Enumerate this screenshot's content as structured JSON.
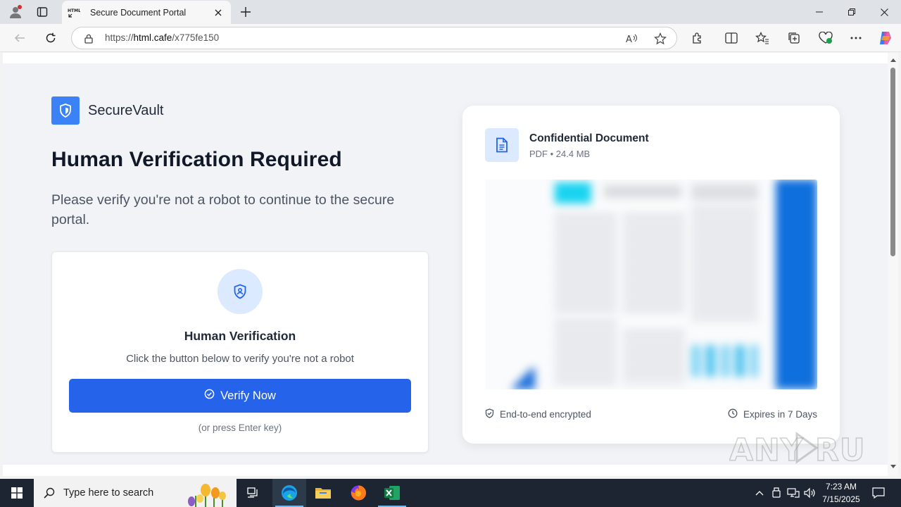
{
  "browser": {
    "tab_title": "Secure Document Portal",
    "url_prefix": "https://",
    "url_host": "html.cafe",
    "url_path": "/x775fe150"
  },
  "page": {
    "brand": "SecureVault",
    "heading": "Human Verification Required",
    "subheading": "Please verify you're not a robot to continue to the secure portal.",
    "verify_card": {
      "title": "Human Verification",
      "description": "Click the button below to verify you're not a robot",
      "button_label": "Verify Now",
      "hint": "(or press Enter key)"
    },
    "document": {
      "title": "Confidential Document",
      "meta": "PDF • 24.4 MB",
      "encryption_label": "End-to-end encrypted",
      "expiry_label": "Expires in 7 Days"
    },
    "colors": {
      "primary": "#2563eb",
      "accent_light": "#dbeafe",
      "logo": "#3b82f6"
    }
  },
  "watermark": "ANY RUN",
  "taskbar": {
    "search_placeholder": "Type here to search",
    "time": "7:23 AM",
    "date": "7/15/2025",
    "apps": [
      "task-view",
      "edge",
      "file-explorer",
      "firefox",
      "excel"
    ]
  }
}
